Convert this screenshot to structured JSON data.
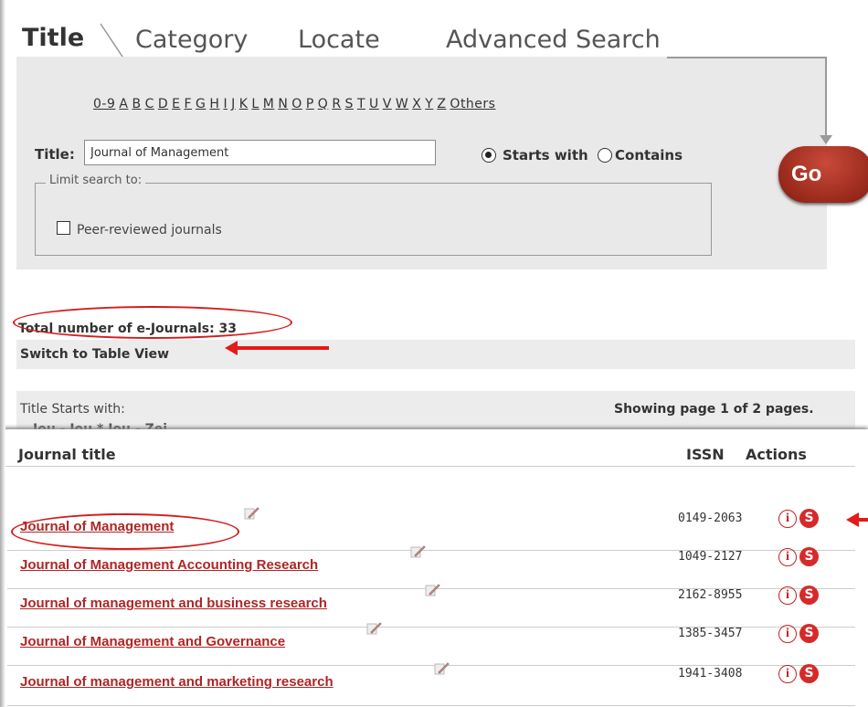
{
  "tabs": [
    "Title",
    "Category",
    "Locate",
    "Advanced Search"
  ],
  "alphabet": [
    "0-9",
    "A",
    "B",
    "C",
    "D",
    "E",
    "F",
    "G",
    "H",
    "I",
    "J",
    "K",
    "L",
    "M",
    "N",
    "O",
    "P",
    "Q",
    "R",
    "S",
    "T",
    "U",
    "V",
    "W",
    "X",
    "Y",
    "Z",
    "Others"
  ],
  "search": {
    "title_label": "Title:",
    "title_value": "Journal of Management",
    "starts_with_label": "Starts with",
    "contains_label": "Contains",
    "selected_mode": "Starts with",
    "go_label": "Go",
    "limit_legend": "Limit search to:",
    "peer_label": "Peer-reviewed journals"
  },
  "results": {
    "total_label": "Total number of e-Journals: 33",
    "switch_view": "Switch to Table View",
    "starts_label": "Title Starts with:",
    "showing": "Showing page 1 of 2 pages.",
    "range_partial": "Jou - Jou * Jou - Zei"
  },
  "table": {
    "headers": {
      "title": "Journal title",
      "issn": "ISSN",
      "actions": "Actions"
    },
    "rows": [
      {
        "title": "Journal of Management",
        "issn": "0149-2063"
      },
      {
        "title": "Journal of Management Accounting Research",
        "issn": "1049-2127"
      },
      {
        "title": "Journal of management and business research",
        "issn": "2162-8955"
      },
      {
        "title": "Journal of Management and Governance",
        "issn": "1385-3457"
      },
      {
        "title": "Journal of management and marketing research",
        "issn": "1941-3408"
      }
    ]
  },
  "colors": {
    "accent": "#b02525",
    "go_button": "#a8301f",
    "annotation": "#e21b1b",
    "panel_gray": "#e9e9e9"
  },
  "icons": {
    "info": "info-icon",
    "full_text": "s-logo-icon",
    "edit": "pen-paper-icon"
  }
}
